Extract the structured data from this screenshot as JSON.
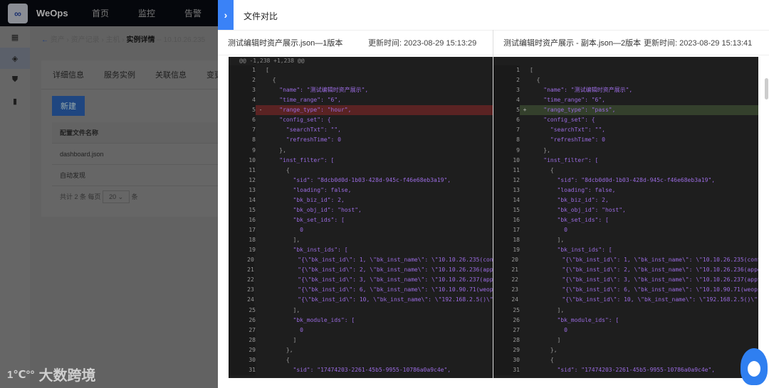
{
  "app": {
    "brand": "WeOps",
    "nav": [
      "首页",
      "监控",
      "告警"
    ]
  },
  "breadcrumb": {
    "items": [
      "资产",
      "资产记录",
      "主机"
    ],
    "current": "实例详情",
    "suffix": "-- 10.10.26.235"
  },
  "tabs": [
    "详细信息",
    "服务实例",
    "关联信息",
    "变更"
  ],
  "new_button": "新建",
  "table": {
    "header": "配置文件名称",
    "rows": [
      "dashboard.json",
      "自动发现"
    ],
    "pagination": {
      "total": "共计 2 条",
      "per_page_label": "每页",
      "per_page": "20",
      "unit": "条"
    }
  },
  "watermark": "大数跨境",
  "watermark_logo": "1688",
  "drawer": {
    "title": "文件对比",
    "left": {
      "file": "测试编辑时资产展示.json—1版本",
      "updated_label": "更新时间:",
      "updated": "2023-08-29 15:13:29"
    },
    "right": {
      "file": "测试编辑时资产展示 - 副本.json—2版本",
      "updated_label": "更新时间:",
      "updated": "2023-08-29 15:13:41"
    },
    "hunk": "@@ -1,238 +1,238 @@"
  },
  "code_left": [
    "[",
    "  {",
    "    \"name\": \"测试编辑时资产展示\",",
    "    \"time_range\": \"6\",",
    "    \"range_type\": \"hour\",",
    "    \"config_set\": {",
    "      \"searchTxt\": \"\",",
    "      \"refreshTime\": 0",
    "    },",
    "    \"inst_filter\": [",
    "      {",
    "        \"sid\": \"8dcb0d0d-1b03-428d-945c-f46e68eb3a19\",",
    "        \"loading\": false,",
    "        \"bk_biz_id\": 2,",
    "        \"bk_obj_id\": \"host\",",
    "        \"bk_set_ids\": [",
    "          0",
    "        ],",
    "        \"bk_inst_ids\": [",
    "          \"{\\\"bk_inst_id\\\": 1, \\\"bk_inst_name\\\": \\\"10.10.26.235(control",
    "          \"{\\\"bk_inst_id\\\": 2, \\\"bk_inst_name\\\": \\\"10.10.26.236(appo)\\\"",
    "          \"{\\\"bk_inst_id\\\": 3, \\\"bk_inst_name\\\": \\\"10.10.26.237(appt)\\\"",
    "          \"{\\\"bk_inst_id\\\": 6, \\\"bk_inst_name\\\": \\\"10.10.90.71(weops)\\\"",
    "          \"{\\\"bk_inst_id\\\": 10, \\\"bk_inst_name\\\": \\\"192.168.2.5()\\\", \\\"",
    "        ],",
    "        \"bk_module_ids\": [",
    "          0",
    "        ]",
    "      },",
    "      {",
    "        \"sid\": \"17474203-2261-45b5-9955-10786a0a9c4e\","
  ],
  "code_right_changed": {
    "line": 5,
    "text": "    \"range_type\": \"pass\","
  },
  "diff": {
    "removed_line": 5,
    "added_line": 5,
    "removed_marker": "-",
    "added_marker": "+"
  }
}
